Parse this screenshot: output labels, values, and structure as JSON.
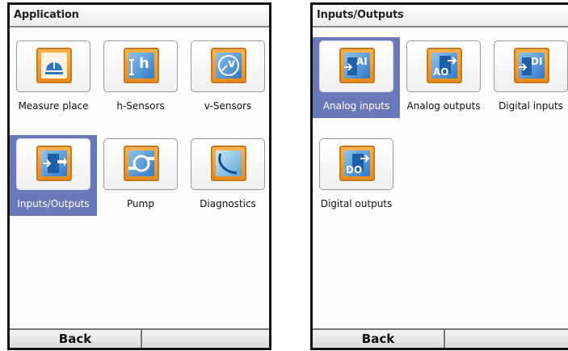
{
  "left_screen": {
    "title": "Application",
    "tiles": [
      {
        "label": "Measure place",
        "icon": "measure-place-icon",
        "selected": false
      },
      {
        "label": "h-Sensors",
        "icon": "h-sensor-icon",
        "selected": false,
        "glyph": "h"
      },
      {
        "label": "v-Sensors",
        "icon": "v-sensor-icon",
        "selected": false,
        "glyph": "v"
      },
      {
        "label": "Inputs/Outputs",
        "icon": "inputs-outputs-icon",
        "selected": true
      },
      {
        "label": "Pump",
        "icon": "pump-icon",
        "selected": false
      },
      {
        "label": "Diagnostics",
        "icon": "diagnostics-icon",
        "selected": false
      }
    ],
    "softkeys": {
      "left": "Back",
      "right": ""
    }
  },
  "right_screen": {
    "title": "Inputs/Outputs",
    "tiles": [
      {
        "label": "Analog inputs",
        "icon": "analog-inputs-icon",
        "selected": true,
        "glyph": "AI"
      },
      {
        "label": "Analog outputs",
        "icon": "analog-outputs-icon",
        "selected": false,
        "glyph": "AO"
      },
      {
        "label": "Digital inputs",
        "icon": "digital-inputs-icon",
        "selected": false,
        "glyph": "DI"
      },
      {
        "label": "Digital outputs",
        "icon": "digital-outputs-icon",
        "selected": false,
        "glyph": "DO"
      }
    ],
    "softkeys": {
      "left": "Back",
      "right": ""
    }
  },
  "colors": {
    "selection": "#6a79b8",
    "icon_orange": "#f39a2a",
    "icon_blue": "#2f78c8"
  }
}
